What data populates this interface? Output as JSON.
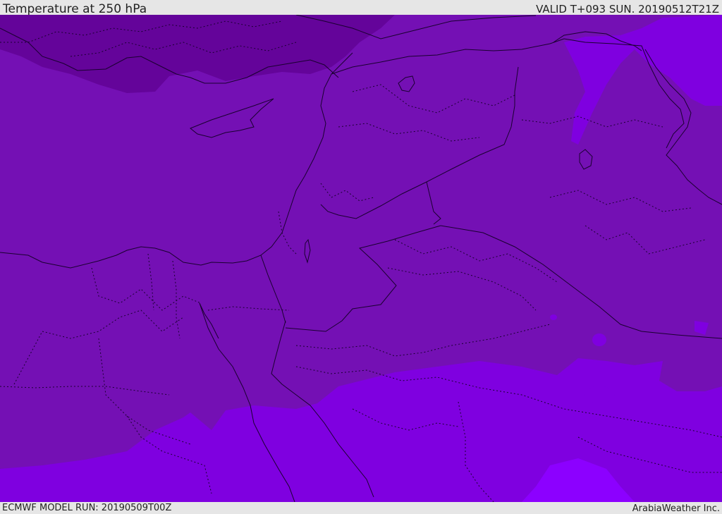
{
  "header": {
    "title": "Temperature at 250 hPa",
    "valid_time": "VALID T+093 SUN. 20190512T21Z"
  },
  "footer": {
    "model_run": "ECMWF MODEL RUN: 20190509T00Z",
    "credit": "ArabiaWeather Inc."
  },
  "map": {
    "fill_colors": {
      "coldest_band": "#64049a",
      "cold_band": "#7410b4",
      "mid_band": "#7f00e0",
      "warm_band": "#8c00ff"
    },
    "line_color": "#1a0030"
  }
}
